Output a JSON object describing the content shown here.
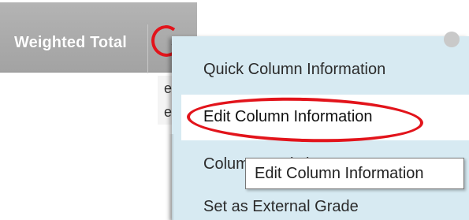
{
  "header": {
    "column_title": "Weighted Total",
    "menu_icon": "chevron-down-icon"
  },
  "fragments": [
    "e",
    "e"
  ],
  "menu": {
    "items": [
      {
        "label": "Quick Column Information",
        "highlighted": false
      },
      {
        "label": "Edit Column Information",
        "highlighted": true
      },
      {
        "label": "Column Statistics",
        "highlighted": false
      },
      {
        "label": "Set as External Grade",
        "highlighted": false
      }
    ]
  },
  "tooltip": {
    "text": "Edit Column Information"
  },
  "colors": {
    "header_bg": "#aaaaaa",
    "menu_bg": "#d7eaf2",
    "annotation_red": "#e2141b"
  }
}
